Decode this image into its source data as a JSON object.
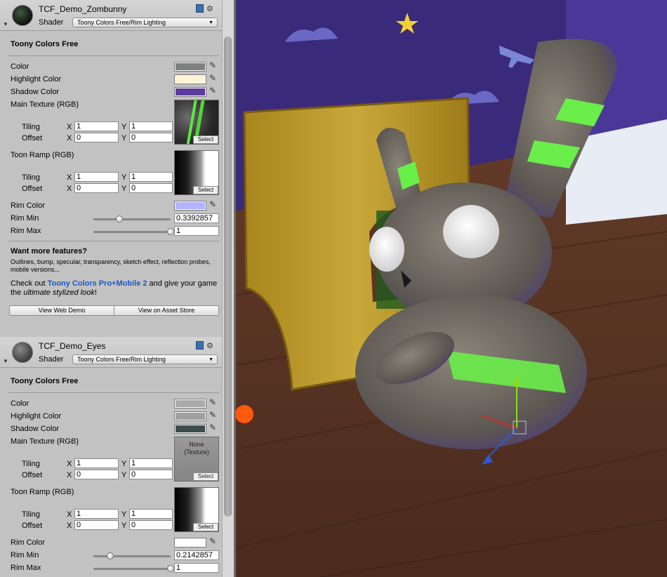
{
  "materials": [
    {
      "name": "TCF_Demo_Zombunny",
      "shader_label": "Shader",
      "shader": "Toony Colors Free/Rim Lighting",
      "section_title": "Toony Colors Free",
      "color_label": "Color",
      "highlight_label": "Highlight Color",
      "shadow_label": "Shadow Color",
      "main_tex_label": "Main Texture (RGB)",
      "toon_ramp_label": "Toon Ramp (RGB)",
      "tiling_label": "Tiling",
      "offset_label": "Offset",
      "x_label": "X",
      "y_label": "Y",
      "main_tiling_x": "1",
      "main_tiling_y": "1",
      "main_offset_x": "0",
      "main_offset_y": "0",
      "ramp_tiling_x": "1",
      "ramp_tiling_y": "1",
      "ramp_offset_x": "0",
      "ramp_offset_y": "0",
      "select_label": "Select",
      "rim_color_label": "Rim Color",
      "rim_min_label": "Rim Min",
      "rim_max_label": "Rim Max",
      "rim_min": "0.3392857",
      "rim_max": "1",
      "colors": {
        "color": "#808080",
        "highlight": "#fff4d6",
        "shadow": "#5c3c99",
        "rim": "#b3b3ff"
      }
    },
    {
      "name": "TCF_Demo_Eyes",
      "shader_label": "Shader",
      "shader": "Toony Colors Free/Rim Lighting",
      "section_title": "Toony Colors Free",
      "color_label": "Color",
      "highlight_label": "Highlight Color",
      "shadow_label": "Shadow Color",
      "main_tex_label": "Main Texture (RGB)",
      "toon_ramp_label": "Toon Ramp (RGB)",
      "tiling_label": "Tiling",
      "offset_label": "Offset",
      "x_label": "X",
      "y_label": "Y",
      "main_tiling_x": "1",
      "main_tiling_y": "1",
      "main_offset_x": "0",
      "main_offset_y": "0",
      "ramp_tiling_x": "1",
      "ramp_tiling_y": "1",
      "ramp_offset_x": "0",
      "ramp_offset_y": "0",
      "select_label": "Select",
      "main_tex_none": "None",
      "main_tex_type": "(Texture)",
      "rim_color_label": "Rim Color",
      "rim_min_label": "Rim Min",
      "rim_max_label": "Rim Max",
      "rim_min": "0.2142857",
      "rim_max": "1",
      "colors": {
        "color": "#ababab",
        "highlight": "#a0a0a0",
        "shadow": "#3d4d4d",
        "rim": "#ffffff"
      }
    }
  ],
  "promo": {
    "heading": "Want more features?",
    "features": "Outlines, bump, specular, transparency, sketch effect, reflection probes, mobile versions...",
    "check_out": "Check out ",
    "product": "Toony Colors Pro+Mobile 2",
    "and_give": " and give your game the ",
    "emphasis": "ultimate stylized look",
    "end": "!",
    "btn_web_demo": "View Web Demo",
    "btn_asset_store": "View on Asset Store"
  },
  "slider_levels": {
    "zombunny_rim_min": 0.3392857,
    "zombunny_rim_max": 1,
    "eyes_rim_min": 0.2142857,
    "eyes_rim_max": 1
  }
}
